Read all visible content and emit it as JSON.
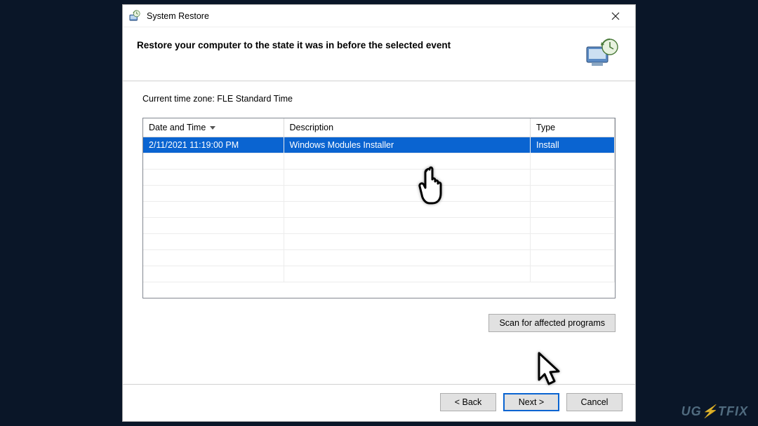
{
  "window": {
    "title": "System Restore"
  },
  "header": {
    "heading": "Restore your computer to the state it was in before the selected event"
  },
  "content": {
    "timezone_label": "Current time zone: FLE Standard Time",
    "columns": {
      "date": "Date and Time",
      "description": "Description",
      "type": "Type"
    },
    "rows": [
      {
        "date": "2/11/2021 11:19:00 PM",
        "description": "Windows Modules Installer",
        "type": "Install"
      }
    ],
    "scan_button": "Scan for affected programs"
  },
  "footer": {
    "back": "< Back",
    "next": "Next >",
    "cancel": "Cancel"
  },
  "watermark": "UG⚡TFIX"
}
